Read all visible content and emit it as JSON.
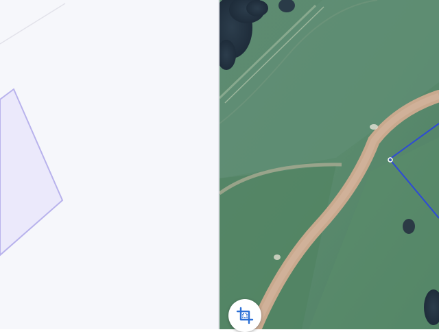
{
  "map": {
    "left_view": {
      "background": "#f6f7fb",
      "parcel_fill": "#ebe9fb",
      "parcel_stroke": "#b8b2ec"
    },
    "right_view": {
      "type": "satellite",
      "parcel_stroke": "#2d49d8"
    }
  },
  "controls": {
    "crop_button": {
      "icon": "crop-icon",
      "color": "#2a6fd6"
    }
  }
}
